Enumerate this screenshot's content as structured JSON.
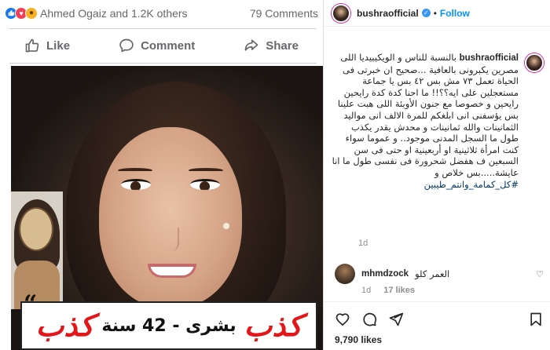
{
  "facebook": {
    "reactions": {
      "names": "Ahmed Ogaiz and 1.2K others",
      "comments": "79 Comments",
      "icons": [
        "like-icon",
        "love-icon",
        "wow-icon"
      ]
    },
    "actions": {
      "like": "Like",
      "comment": "Comment",
      "share": "Share"
    },
    "image": {
      "banner_red": "كذب",
      "banner_text": "بشرى - 42 سنة"
    }
  },
  "instagram": {
    "header": {
      "username": "bushraofficial",
      "dot": "•",
      "follow": "Follow"
    },
    "caption": {
      "username": "bushraofficial",
      "text": "بالنسبة للناس و الويكيبيديا اللى مصرين يكبرونى بالعافية ...صحيح ان خبرتى فى الحياة تعمل ٧٣ مش بس ٤٢ بس يا جماعة مستعجلين على ايه؟؟!! ما احنا كدة كدة رايحين رايحين و خصوصا مع جنون الأوبئة اللى هبت علينا بس يؤسفنى انى ابلغكم للمرة الالف انى مواليد الثمانينات والله ثمانينات و محدش يقدر يكذب طول ما السجل المدنى موجود.. و عموما سواء كنت امرأة ثلاثينية او أربعينية او حتى فى سن السبعين ف هفضل شحرورة فى نفسى طول ما انا عايشة.....بس خلاص و",
      "hashtag": "#كل_كمامة_وانتم_طيبين",
      "time": "1d"
    },
    "comment": {
      "username": "mhmdzock",
      "text": "العمر كلو",
      "time": "1d",
      "likes": "17 likes"
    },
    "likes": "9,790 likes"
  }
}
